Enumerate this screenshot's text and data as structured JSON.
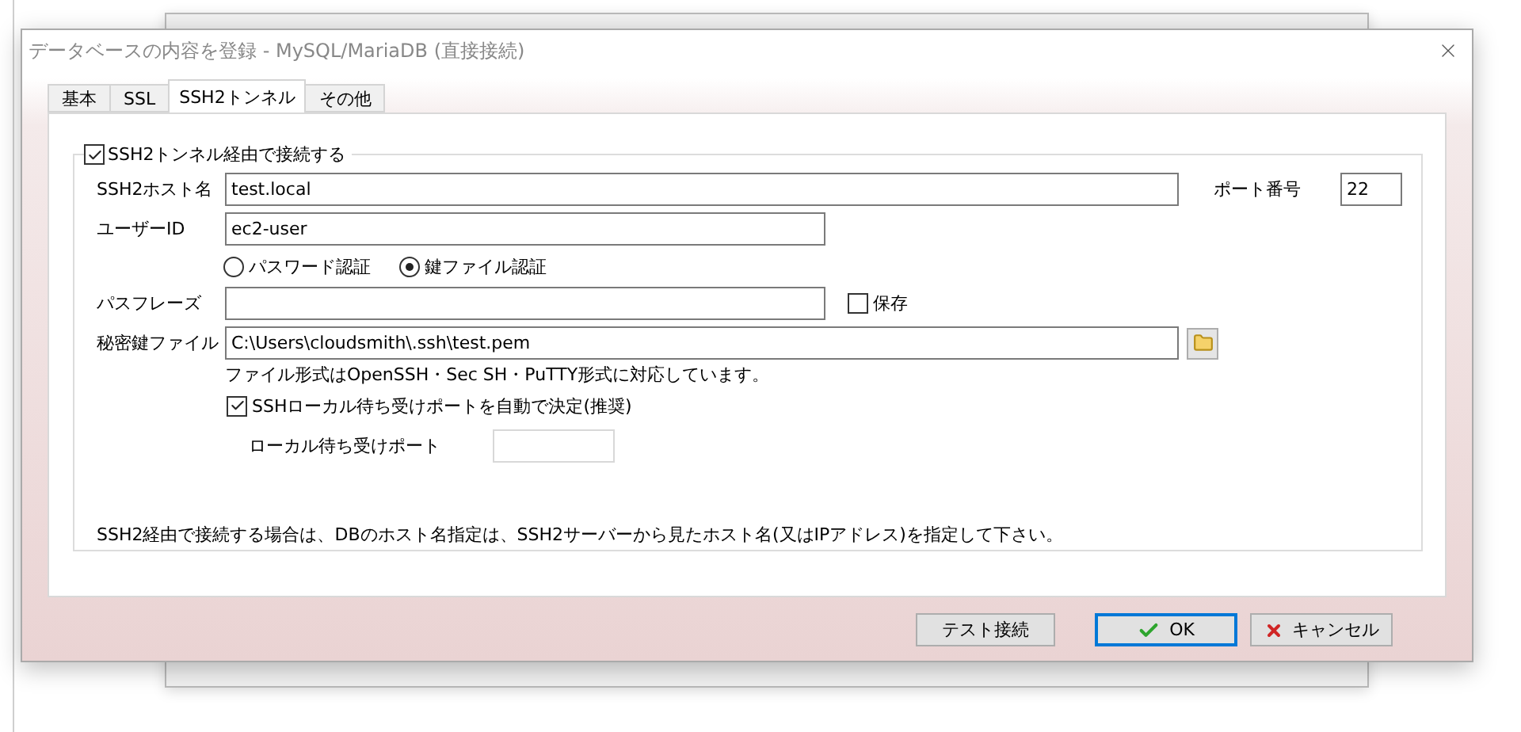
{
  "window": {
    "title": "データベースの内容を登録 - MySQL/MariaDB (直接接続)"
  },
  "tabs": [
    {
      "label": "基本",
      "selected": false
    },
    {
      "label": "SSL",
      "selected": false
    },
    {
      "label": "SSH2トンネル",
      "selected": true
    },
    {
      "label": "その他",
      "selected": false
    }
  ],
  "tunnel": {
    "label": "SSH2トンネル経由で接続する",
    "checked": true
  },
  "host": {
    "label": "SSH2ホスト名",
    "value": "test.local"
  },
  "port": {
    "label": "ポート番号",
    "value": "22"
  },
  "user": {
    "label": "ユーザーID",
    "value": "ec2-user"
  },
  "auth": [
    {
      "label": "パスワード認証",
      "selected": false
    },
    {
      "label": "鍵ファイル認証",
      "selected": true
    }
  ],
  "passphrase": {
    "label": "パスフレーズ",
    "save": {
      "label": "保存",
      "checked": false
    }
  },
  "key_file": {
    "label": "秘密鍵ファイル",
    "value": "C:\\Users\\cloudsmith\\.ssh\\test.pem",
    "hint": "ファイル形式はOpenSSH・Sec SH・PuTTY形式に対応しています。"
  },
  "auto_port": {
    "label": "SSHローカル待ち受けポートを自動で決定(推奨)",
    "checked": true
  },
  "local_port": {
    "label": "ローカル待ち受けポート",
    "disabled": true
  },
  "note": "SSH2経由で接続する場合は、DBのホスト名指定は、SSH2サーバーから見たホスト名(又はIPアドレス)を指定して下さい。",
  "buttons": [
    {
      "kind": "plain",
      "label": "テスト接続"
    },
    {
      "kind": "ok",
      "label": "OK"
    },
    {
      "kind": "cancel",
      "label": "キャンセル"
    }
  ]
}
